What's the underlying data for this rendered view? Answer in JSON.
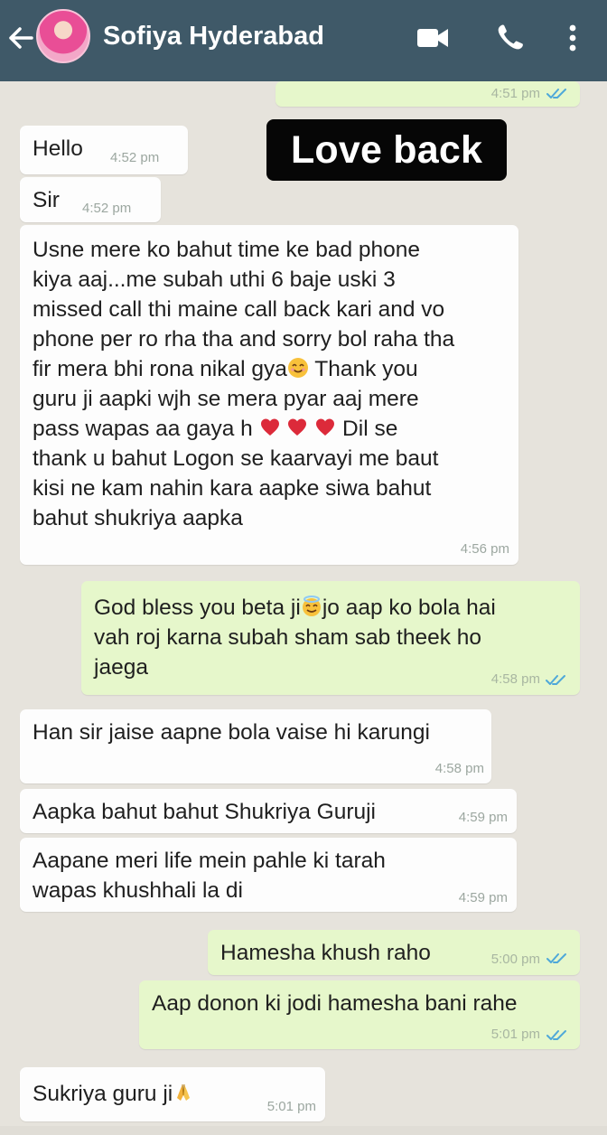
{
  "header": {
    "contact_name": "Sofiya Hyderabad"
  },
  "watermark": {
    "text": "Love back"
  },
  "messages": [
    {
      "direction": "out",
      "time": "4:51 pm"
    },
    {
      "direction": "in",
      "text": "Hello",
      "time": "4:52 pm"
    },
    {
      "direction": "in",
      "text": "Sir",
      "time": "4:52 pm"
    },
    {
      "direction": "in",
      "line_1": "Usne mere ko bahut time ke bad phone",
      "line_2": "kiya aaj...me subah uthi 6 baje uski 3",
      "line_3": "missed call thi maine call back kari and vo",
      "line_4": "phone per ro rha tha and sorry bol raha tha",
      "line_5a": "fir mera bhi rona nikal gya",
      "line_5b": " Thank you",
      "line_6": "guru ji aapki wjh se mera pyar aaj mere",
      "line_7a": "pass wapas aa gaya h ",
      "line_7b": " Dil se",
      "line_8": "thank u bahut Logon se kaarvayi me baut",
      "line_9": "kisi ne kam nahin kara aapke siwa bahut",
      "line_10": "bahut shukriya aapka",
      "time": "4:56 pm"
    },
    {
      "direction": "out",
      "line_1a": "God bless you beta ji",
      "line_1b": "jo aap ko bola hai",
      "line_2": "vah roj karna subah sham sab theek ho",
      "line_3": "jaega",
      "time": "4:58 pm"
    },
    {
      "direction": "in",
      "text": "Han sir jaise aapne bola vaise hi karungi",
      "time": "4:58 pm"
    },
    {
      "direction": "in",
      "text": "Aapka bahut bahut Shukriya Guruji",
      "time": "4:59 pm"
    },
    {
      "direction": "in",
      "line_1": "Aapane meri life mein pahle ki tarah",
      "line_2": "wapas khushhali la di",
      "time": "4:59 pm"
    },
    {
      "direction": "out",
      "text": "Hamesha khush raho",
      "time": "5:00 pm"
    },
    {
      "direction": "out",
      "text": "Aap donon ki jodi hamesha bani rahe",
      "time": "5:01 pm"
    },
    {
      "direction": "in",
      "text": "Sukriya guru ji",
      "time": "5:01 pm"
    }
  ],
  "icons": {
    "back": "arrow-left-icon",
    "video": "video-camera-icon",
    "call": "phone-icon",
    "menu": "more-vertical-icon",
    "read_receipt": "double-check-icon"
  },
  "colors": {
    "header": "#3f5968",
    "incoming_bubble": "#fdfdfd",
    "outgoing_bubble": "#e6f7cb",
    "read_receipt": "#4fa8d9",
    "chat_background": "#e6e3dc"
  }
}
